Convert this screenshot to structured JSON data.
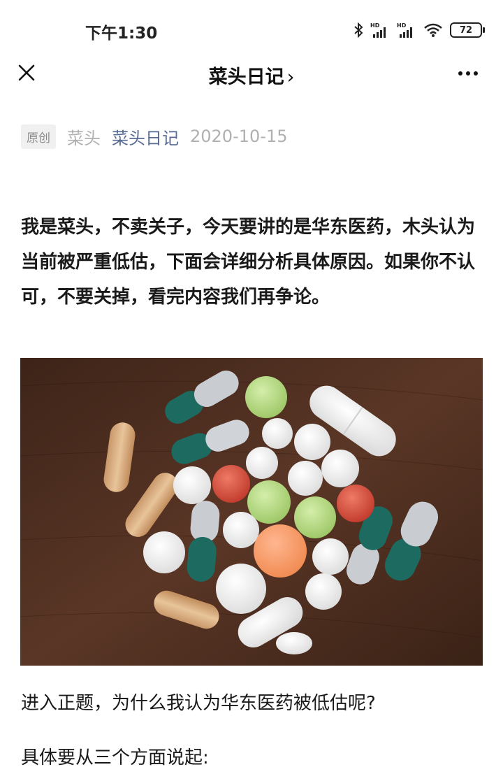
{
  "status_bar": {
    "time": "下午1:30",
    "battery": "72",
    "icons": [
      "bluetooth-icon",
      "signal-hd-icon",
      "signal-hd-icon",
      "wifi-icon",
      "battery-icon"
    ]
  },
  "nav": {
    "title": "菜头日记",
    "chevron": "›",
    "close_icon": "close-icon",
    "more_icon": "more-icon"
  },
  "meta": {
    "badge": "原创",
    "author": "菜头",
    "account": "菜头日记",
    "date": "2020-10-15"
  },
  "article": {
    "intro": "我是菜头，不卖关子，今天要讲的是华东医药，木头认为当前被严重低估，下面会详细分析具体原因。如果你不认可，不要关掉，看完内容我们再争论。",
    "paragraphs": [
      "进入正题，为什么我认为华东医药被低估呢?",
      "具体要从三个方面说起:"
    ]
  },
  "colors": {
    "link": "#576b95",
    "meta_gray": "#b0b0b0",
    "wood": "#4a2c1c"
  }
}
